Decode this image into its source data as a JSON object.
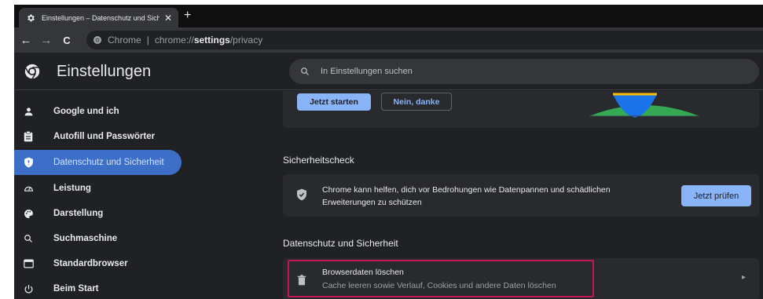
{
  "tab": {
    "title": "Einstellungen – Datenschutz und Sicherheit",
    "close": "✕",
    "new_tab": "+"
  },
  "toolbar": {
    "back": "←",
    "forward": "→",
    "reload": "C",
    "host": "Chrome",
    "separator": "|",
    "url_prefix": "chrome://",
    "url_strong": "settings",
    "url_suffix": "/privacy"
  },
  "header": {
    "title": "Einstellungen",
    "search_placeholder": "In Einstellungen suchen"
  },
  "sidebar": {
    "items": [
      {
        "label": "Google und ich",
        "icon": "person-icon"
      },
      {
        "label": "Autofill und Passwörter",
        "icon": "clipboard-icon"
      },
      {
        "label": "Datenschutz und Sicherheit",
        "icon": "shield-icon",
        "active": true
      },
      {
        "label": "Leistung",
        "icon": "speedometer-icon"
      },
      {
        "label": "Darstellung",
        "icon": "palette-icon"
      },
      {
        "label": "Suchmaschine",
        "icon": "search-icon"
      },
      {
        "label": "Standardbrowser",
        "icon": "browser-icon"
      },
      {
        "label": "Beim Start",
        "icon": "power-icon"
      }
    ]
  },
  "promo": {
    "start_label": "Jetzt starten",
    "decline_label": "Nein, danke"
  },
  "safety_check": {
    "heading": "Sicherheitscheck",
    "text": "Chrome kann helfen, dich vor Bedrohungen wie Datenpannen und schädlichen Erweiterungen zu schützen",
    "button": "Jetzt prüfen"
  },
  "privacy": {
    "heading": "Datenschutz und Sicherheit",
    "clear_title": "Browserdaten löschen",
    "clear_subtitle": "Cache leeren sowie Verlauf, Cookies und andere Daten löschen",
    "chevron": "▸"
  },
  "colors": {
    "accent": "#8ab4f8",
    "active_nav": "#3e6fc8",
    "highlight": "#c2185b",
    "background": "#202124",
    "card": "#292a2d"
  }
}
